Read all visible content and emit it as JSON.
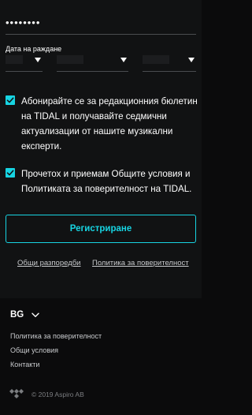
{
  "form": {
    "password_masked": "••••••••",
    "dob_label": "Дата на раждане"
  },
  "checkboxes": [
    {
      "checked": true,
      "text": "Абонирайте се за редакционния бюлетин на TIDAL и получавайте седмични актуализации от нашите музикални експерти."
    },
    {
      "checked": true,
      "text": "Прочетох и приемам Общите условия и Политиката за поверителност на TIDAL."
    }
  ],
  "register_button": "Регистриране",
  "legal_links": {
    "terms": "Общи разпоредби",
    "privacy": "Политика за поверителност"
  },
  "footer": {
    "language": "BG",
    "links": [
      "Политика за поверителност",
      "Общи условия",
      "Контакти"
    ],
    "copyright": "© 2019 Aspiro AB"
  },
  "colors": {
    "accent": "#17d4e2",
    "background": "#0b0b0c",
    "panel": "#111213",
    "divider": "#4a4c4f"
  },
  "icons": [
    "chevron-down-icon",
    "checkmark-icon",
    "tidal-logo-icon"
  ]
}
